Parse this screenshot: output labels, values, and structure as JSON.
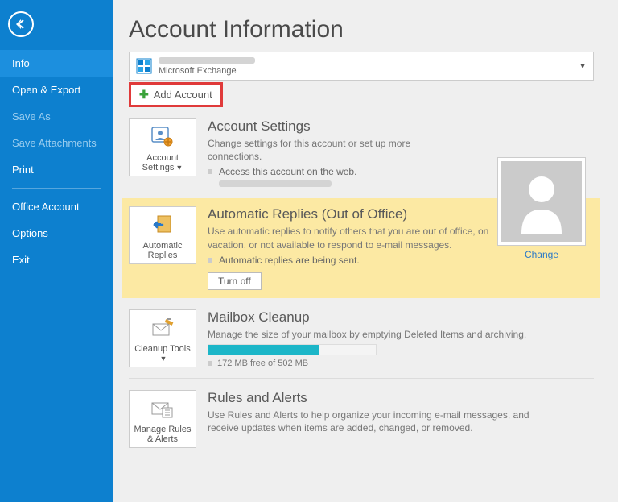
{
  "sidebar": {
    "items": [
      {
        "label": "Info",
        "state": "selected"
      },
      {
        "label": "Open & Export",
        "state": "normal"
      },
      {
        "label": "Save As",
        "state": "disabled"
      },
      {
        "label": "Save Attachments",
        "state": "disabled"
      },
      {
        "label": "Print",
        "state": "normal"
      },
      {
        "label": "Office Account",
        "state": "normal"
      },
      {
        "label": "Options",
        "state": "normal"
      },
      {
        "label": "Exit",
        "state": "normal"
      }
    ]
  },
  "page": {
    "title": "Account Information"
  },
  "account": {
    "type": "Microsoft Exchange",
    "add_btn": "Add Account"
  },
  "settings": {
    "tile": "Account Settings",
    "title": "Account Settings",
    "desc": "Change settings for this account or set up more connections.",
    "link": "Access this account on the web."
  },
  "avatar": {
    "change": "Change"
  },
  "autoreply": {
    "tile": "Automatic Replies",
    "title": "Automatic Replies (Out of Office)",
    "desc": "Use automatic replies to notify others that you are out of office, on vacation, or not available to respond to e-mail messages.",
    "status": "Automatic replies are being sent.",
    "turn_off": "Turn off"
  },
  "cleanup": {
    "tile": "Cleanup Tools",
    "title": "Mailbox Cleanup",
    "desc": "Manage the size of your mailbox by emptying Deleted Items and archiving.",
    "storage": "172 MB free of 502 MB",
    "used_pct": 66
  },
  "rules": {
    "tile": "Manage Rules & Alerts",
    "title": "Rules and Alerts",
    "desc": "Use Rules and Alerts to help organize your incoming e-mail messages, and receive updates when items are added, changed, or removed."
  }
}
